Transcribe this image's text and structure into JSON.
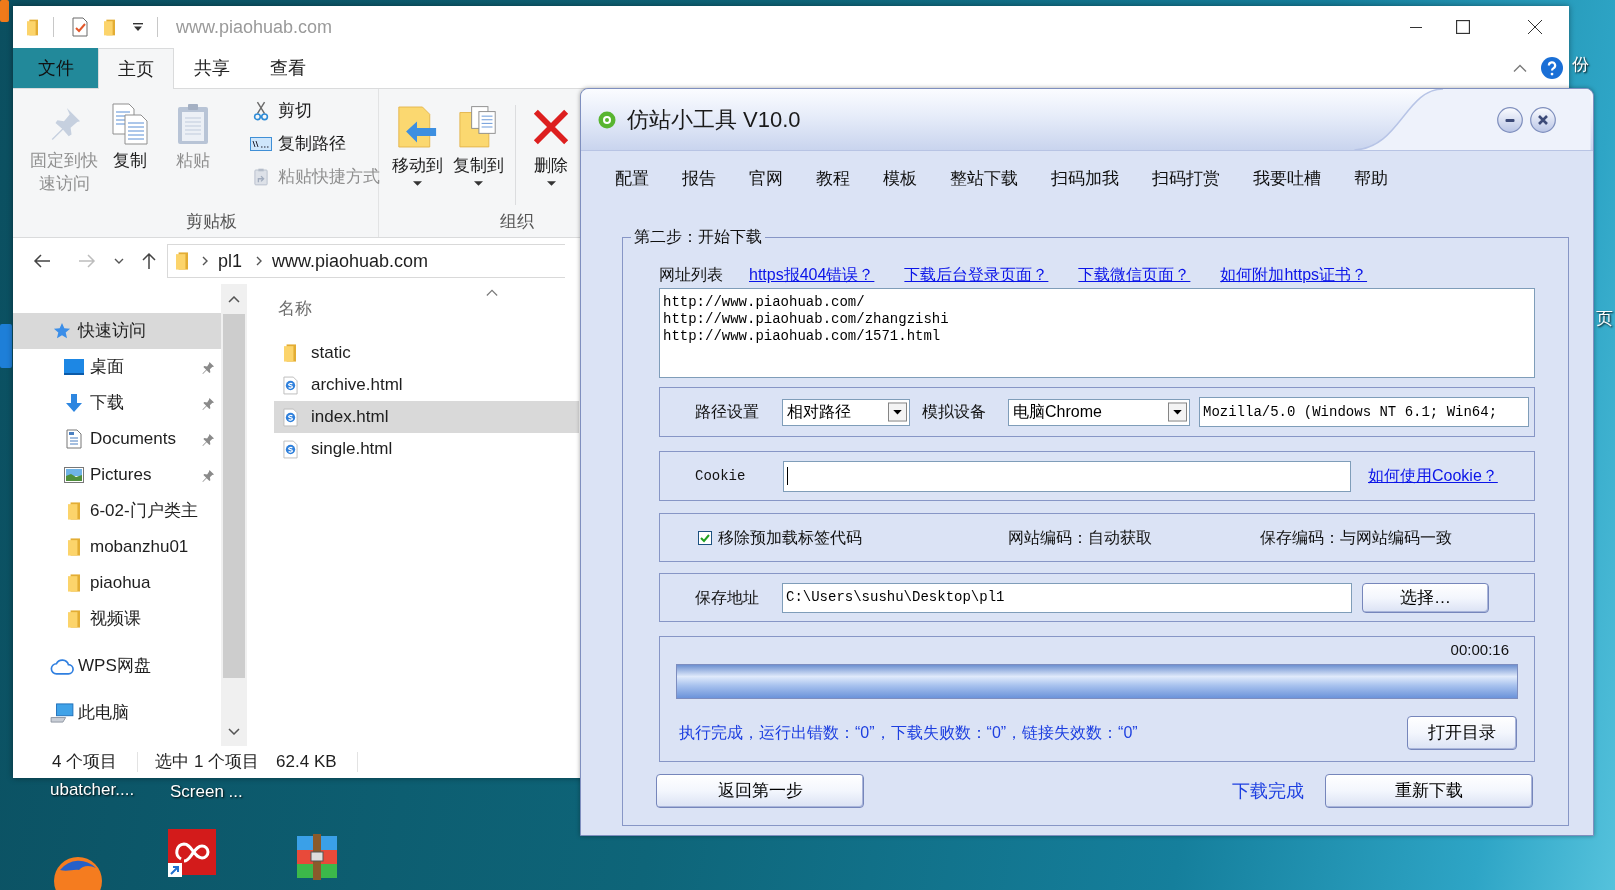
{
  "desktop": {
    "labels": [
      "份",
      "页",
      "ubatcher....",
      "Screen ..."
    ]
  },
  "explorer": {
    "title": "www.piaohuab.com",
    "ribbon_tabs": [
      {
        "label": "文件",
        "kind": "file",
        "selected": false
      },
      {
        "label": "主页",
        "kind": "tab",
        "selected": true
      },
      {
        "label": "共享",
        "kind": "tab",
        "selected": false
      },
      {
        "label": "查看",
        "kind": "tab",
        "selected": false
      }
    ],
    "ribbon_groups": [
      {
        "label": "剪贴板",
        "commands": [
          {
            "label": "固定到快速访问",
            "kind": "large",
            "disabled": true
          },
          {
            "label": "复制",
            "kind": "large",
            "disabled": false
          },
          {
            "label": "粘贴",
            "kind": "large",
            "disabled": true
          },
          {
            "label": "剪切",
            "kind": "small",
            "disabled": false
          },
          {
            "label": "复制路径",
            "kind": "small",
            "disabled": false
          },
          {
            "label": "粘贴快捷方式",
            "kind": "small",
            "disabled": true
          }
        ]
      },
      {
        "label": "组织",
        "commands": [
          {
            "label": "移动到",
            "kind": "menu",
            "disabled": false
          },
          {
            "label": "复制到",
            "kind": "menu",
            "disabled": false
          },
          {
            "label": "删除",
            "kind": "menu",
            "disabled": false
          }
        ]
      }
    ],
    "address": [
      "pl1",
      "www.piaohuab.com"
    ],
    "navigation": [
      {
        "label": "快速访问",
        "kind": "quick",
        "selected": true,
        "children": [
          {
            "label": "桌面",
            "kind": "desktop",
            "pinned": true,
            "selected": false
          },
          {
            "label": "下载",
            "kind": "downloads",
            "pinned": true,
            "selected": false
          },
          {
            "label": "Documents",
            "kind": "documents",
            "pinned": true,
            "selected": false
          },
          {
            "label": "Pictures",
            "kind": "pictures",
            "pinned": true,
            "selected": false
          },
          {
            "label": "6-02-门户类主",
            "kind": "folder",
            "pinned": false,
            "selected": false
          },
          {
            "label": "mobanzhu01",
            "kind": "folder",
            "pinned": false,
            "selected": false
          },
          {
            "label": "piaohua",
            "kind": "folder",
            "pinned": false,
            "selected": false
          },
          {
            "label": "视频课",
            "kind": "folder",
            "pinned": false,
            "selected": false
          }
        ]
      },
      {
        "label": "WPS网盘",
        "kind": "cloud",
        "selected": false
      },
      {
        "label": "此电脑",
        "kind": "computer",
        "selected": false
      }
    ],
    "file_list": {
      "column": "名称",
      "files": [
        {
          "name": "static",
          "kind": "folder",
          "selected": false
        },
        {
          "name": "archive.html",
          "kind": "html",
          "selected": false
        },
        {
          "name": "index.html",
          "kind": "html",
          "selected": true
        },
        {
          "name": "single.html",
          "kind": "html",
          "selected": false
        }
      ]
    },
    "status_bar": [
      "4 个项目",
      "选中 1 个项目",
      "62.4 KB"
    ]
  },
  "tool": {
    "title": "仿站小工具 V10.0",
    "menu": [
      "配置",
      "报告",
      "官网",
      "教程",
      "模板",
      "整站下载",
      "扫码加我",
      "扫码打赏",
      "我要吐槽",
      "帮助"
    ],
    "step": "第二步：开始下载",
    "url_list": {
      "label": "网址列表",
      "help_links": [
        "https报404错误？",
        "下载后台登录页面？",
        "下载微信页面？",
        "如何附加https证书？"
      ],
      "urls": [
        "http://www.piaohuab.com/",
        "http://www.piaohuab.com/zhangzishi",
        "http://www.piaohuab.com/1571.html"
      ]
    },
    "path_settings": {
      "path_label": "路径设置",
      "path_mode": "相对路径",
      "device_label": "模拟设备",
      "device": "电脑Chrome",
      "user_agent": "Mozilla/5.0 (Windows NT 6.1; Win64;"
    },
    "cookie": {
      "label": "Cookie",
      "focused": true,
      "help_link": "如何使用Cookie？"
    },
    "options": {
      "remove_preload": {
        "label": "移除预加载标签代码",
        "checked": true
      },
      "site_encoding": "网站编码：自动获取",
      "save_encoding": "保存编码：与网站编码一致"
    },
    "save_path": {
      "label": "保存地址",
      "value": "C:\\Users\\sushu\\Desktop\\pl1",
      "button": "选择…"
    },
    "progress": {
      "elapsed": "00:00:16",
      "level": 1,
      "status": "执行完成，运行出错数：“0”，下载失败数：“0”，链接失效数：“0”",
      "button": "打开目录"
    },
    "footer": {
      "back_button": "返回第一步",
      "result": "下载完成",
      "restart_button": "重新下载"
    }
  }
}
